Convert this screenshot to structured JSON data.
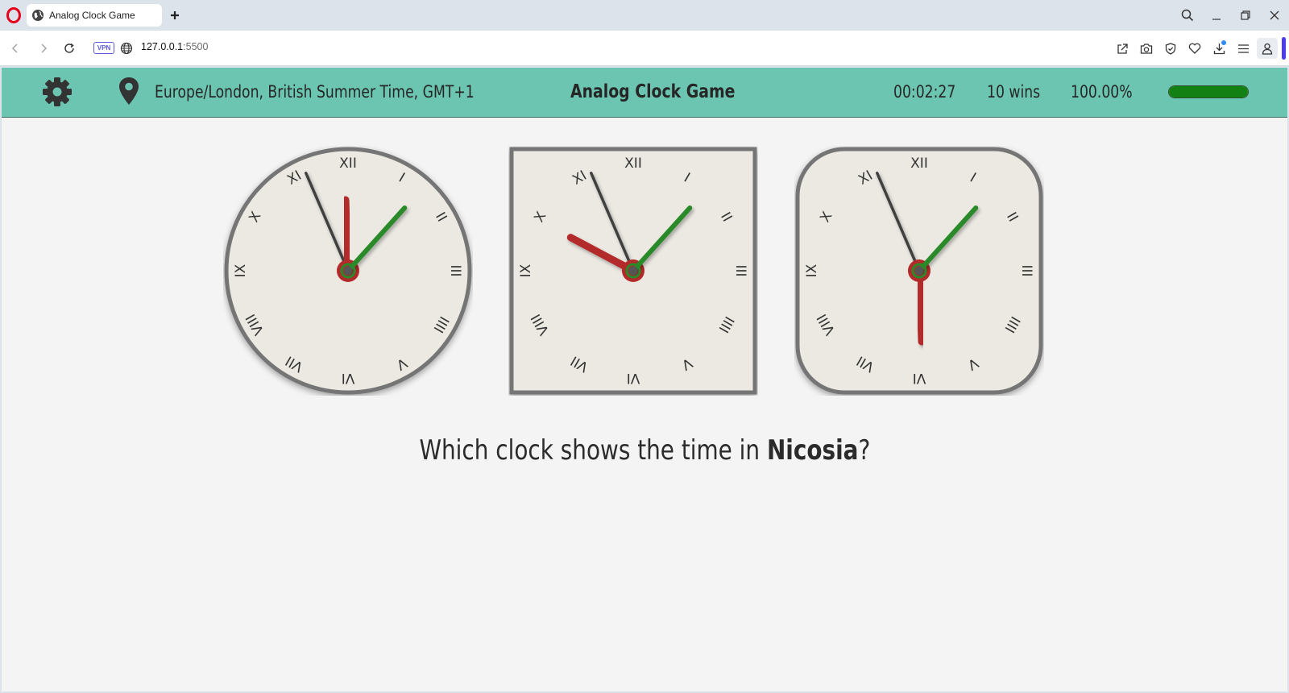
{
  "browser": {
    "tab_title": "Analog Clock Game",
    "vpn_label": "VPN",
    "url_host": "127.0.0.1",
    "url_port": ":5500"
  },
  "header": {
    "timezone": "Europe/London, British Summer Time, GMT+1",
    "title": "Analog Clock Game",
    "timer": "00:02:27",
    "wins": "10 wins",
    "percent": "100.00%",
    "progress_fraction": 1.0
  },
  "colors": {
    "header_bg": "#6cc5b0",
    "hour_hand": "#b22a2a",
    "minute_hand": "#404040",
    "second_hand": "#2a8a2a",
    "face": "#ece9e3",
    "rim": "#757575",
    "progress": "#138013"
  },
  "numerals": [
    "XII",
    "I",
    "II",
    "III",
    "IIII",
    "V",
    "VI",
    "VII",
    "VIII",
    "IX",
    "X",
    "XI"
  ],
  "clocks": [
    {
      "shape": "circle",
      "time": "11:56:07"
    },
    {
      "shape": "square",
      "time": "09:56:07"
    },
    {
      "shape": "rounded-square",
      "time": "17:56:07"
    }
  ],
  "question": {
    "prefix": "Which clock shows the time in ",
    "city": "Nicosia",
    "suffix": "?"
  }
}
